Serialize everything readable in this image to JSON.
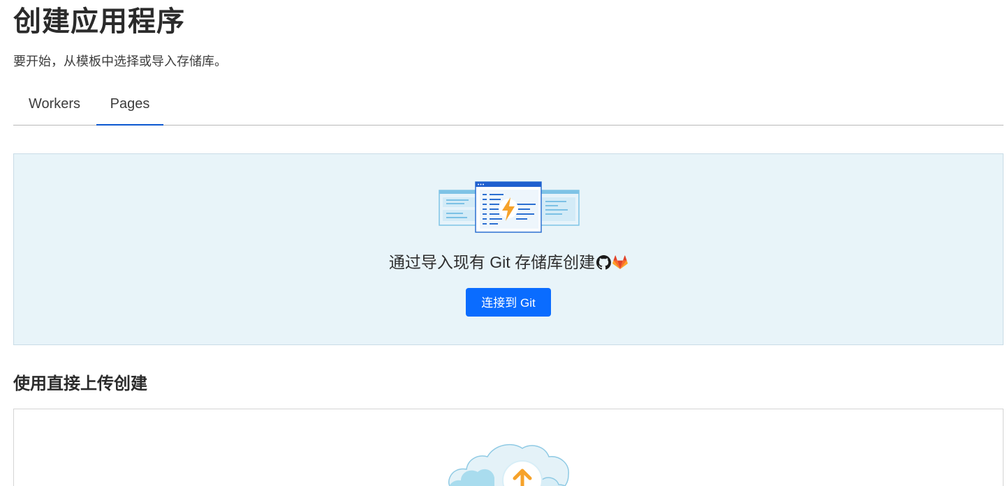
{
  "header": {
    "title": "创建应用程序",
    "subtitle": "要开始，从模板中选择或导入存储库。"
  },
  "tabs": [
    {
      "label": "Workers",
      "active": false
    },
    {
      "label": "Pages",
      "active": true
    }
  ],
  "git_import": {
    "title": "通过导入现有 Git 存储库创建",
    "providers": [
      "github-icon",
      "gitlab-icon"
    ],
    "button_label": "连接到 Git",
    "illustration": "code-window-lightning-icon"
  },
  "direct_upload": {
    "heading": "使用直接上传创建",
    "illustration": "cloud-upload-icon"
  },
  "colors": {
    "accent": "#0a6cff",
    "tab_underline": "#0b57d0",
    "panel_background": "#e8f4f9",
    "lightning": "#f6a22a"
  }
}
